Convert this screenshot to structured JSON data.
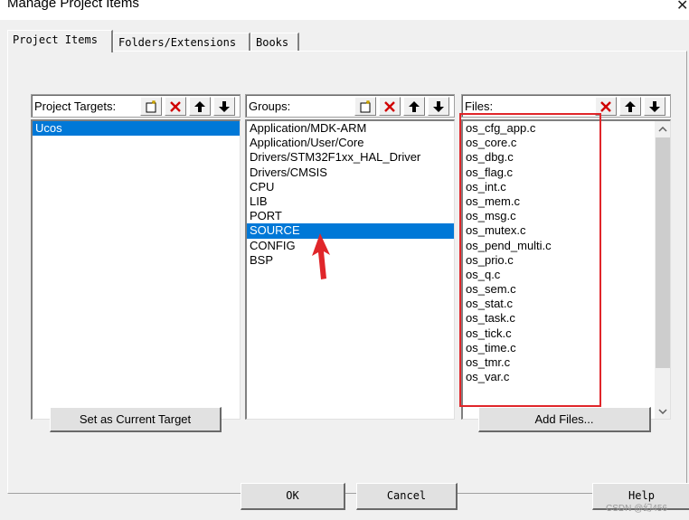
{
  "window": {
    "title": "Manage Project Items"
  },
  "tabs": [
    {
      "label": "Project Items",
      "active": true
    },
    {
      "label": "Folders/Extensions",
      "active": false
    },
    {
      "label": "Books",
      "active": false
    }
  ],
  "targets": {
    "label": "Project Targets:",
    "items": [
      "Ucos"
    ],
    "selected": "Ucos"
  },
  "groups": {
    "label": "Groups:",
    "items": [
      "Application/MDK-ARM",
      "Application/User/Core",
      "Drivers/STM32F1xx_HAL_Driver",
      "Drivers/CMSIS",
      "CPU",
      "LIB",
      "PORT",
      "SOURCE",
      "CONFIG",
      "BSP"
    ],
    "selected": "SOURCE"
  },
  "files": {
    "label": "Files:",
    "items": [
      "os_cfg_app.c",
      "os_core.c",
      "os_dbg.c",
      "os_flag.c",
      "os_int.c",
      "os_mem.c",
      "os_msg.c",
      "os_mutex.c",
      "os_pend_multi.c",
      "os_prio.c",
      "os_q.c",
      "os_sem.c",
      "os_stat.c",
      "os_task.c",
      "os_tick.c",
      "os_time.c",
      "os_tmr.c",
      "os_var.c"
    ]
  },
  "buttons": {
    "set_target": "Set as Current Target",
    "add_files": "Add Files...",
    "ok": "OK",
    "cancel": "Cancel",
    "help": "Help"
  },
  "watermark": "CSDN @幻456",
  "colors": {
    "selection": "#0078d7",
    "annotation": "#e0262a",
    "dialog_bg": "#f0f0f0"
  }
}
